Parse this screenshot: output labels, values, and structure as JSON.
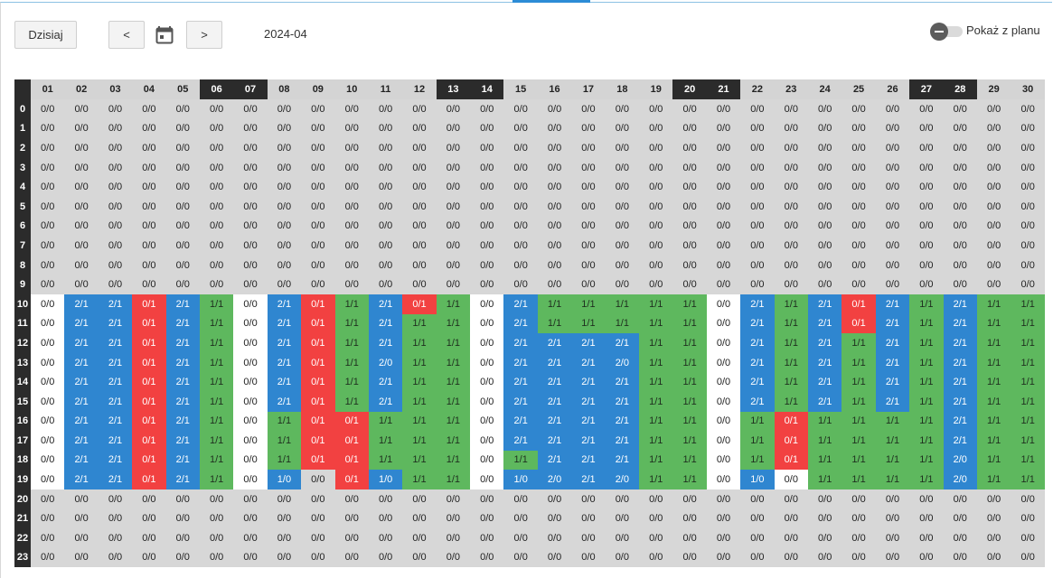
{
  "toolbar": {
    "today_label": "Dzisiaj",
    "prev_label": "<",
    "next_label": ">",
    "calendar_icon": "calendar-icon",
    "period": "2024-04",
    "show_plan_label": "Pokaż z planu",
    "show_plan_enabled": false
  },
  "colors": {
    "gray": "#d7d7d7",
    "white": "#ffffff",
    "blue": "#2f86d0",
    "green": "#5eb85e",
    "red": "#f24141",
    "header_dark": "#2b2b2b",
    "header_light": "#d4d4d4",
    "accent": "#2c8cd6"
  },
  "grid": {
    "days": [
      "01",
      "02",
      "03",
      "04",
      "05",
      "06",
      "07",
      "08",
      "09",
      "10",
      "11",
      "12",
      "13",
      "14",
      "15",
      "16",
      "17",
      "18",
      "19",
      "20",
      "21",
      "22",
      "23",
      "24",
      "25",
      "26",
      "27",
      "28",
      "29",
      "30"
    ],
    "weekend_days": [
      "06",
      "07",
      "13",
      "14",
      "20",
      "21",
      "27",
      "28"
    ],
    "hours": [
      "0",
      "1",
      "2",
      "3",
      "4",
      "5",
      "6",
      "7",
      "8",
      "9",
      "10",
      "11",
      "12",
      "13",
      "14",
      "15",
      "16",
      "17",
      "18",
      "19",
      "20",
      "21",
      "22",
      "23"
    ],
    "default_value": "0/0",
    "default_color": "gray",
    "active_hours": {
      "10": [
        "0/0|white",
        "2/1|blue",
        "2/1|blue",
        "0/1|red",
        "2/1|blue",
        "1/1|green",
        "0/0|white",
        "2/1|blue",
        "0/1|red",
        "1/1|green",
        "2/1|blue",
        "0/1|red",
        "1/1|green",
        "0/0|white",
        "2/1|blue",
        "1/1|green",
        "1/1|green",
        "1/1|green",
        "1/1|green",
        "1/1|green",
        "0/0|white",
        "2/1|blue",
        "1/1|green",
        "2/1|blue",
        "0/1|red",
        "2/1|blue",
        "1/1|green",
        "2/1|blue",
        "1/1|green",
        "1/1|green"
      ],
      "11": [
        "0/0|white",
        "2/1|blue",
        "2/1|blue",
        "0/1|red",
        "2/1|blue",
        "1/1|green",
        "0/0|white",
        "2/1|blue",
        "0/1|red",
        "1/1|green",
        "2/1|blue",
        "1/1|green",
        "1/1|green",
        "0/0|white",
        "2/1|blue",
        "1/1|green",
        "1/1|green",
        "1/1|green",
        "1/1|green",
        "1/1|green",
        "0/0|white",
        "2/1|blue",
        "1/1|green",
        "2/1|blue",
        "0/1|red",
        "2/1|blue",
        "1/1|green",
        "2/1|blue",
        "1/1|green",
        "1/1|green"
      ],
      "12": [
        "0/0|white",
        "2/1|blue",
        "2/1|blue",
        "0/1|red",
        "2/1|blue",
        "1/1|green",
        "0/0|white",
        "2/1|blue",
        "0/1|red",
        "1/1|green",
        "2/1|blue",
        "1/1|green",
        "1/1|green",
        "0/0|white",
        "2/1|blue",
        "2/1|blue",
        "2/1|blue",
        "2/1|blue",
        "1/1|green",
        "1/1|green",
        "0/0|white",
        "2/1|blue",
        "1/1|green",
        "2/1|blue",
        "1/1|green",
        "2/1|blue",
        "1/1|green",
        "2/1|blue",
        "1/1|green",
        "1/1|green"
      ],
      "13": [
        "0/0|white",
        "2/1|blue",
        "2/1|blue",
        "0/1|red",
        "2/1|blue",
        "1/1|green",
        "0/0|white",
        "2/1|blue",
        "0/1|red",
        "1/1|green",
        "2/0|blue",
        "1/1|green",
        "1/1|green",
        "0/0|white",
        "2/1|blue",
        "2/1|blue",
        "2/1|blue",
        "2/0|blue",
        "1/1|green",
        "1/1|green",
        "0/0|white",
        "2/1|blue",
        "1/1|green",
        "2/1|blue",
        "1/1|green",
        "2/1|blue",
        "1/1|green",
        "2/1|blue",
        "1/1|green",
        "1/1|green"
      ],
      "14": [
        "0/0|white",
        "2/1|blue",
        "2/1|blue",
        "0/1|red",
        "2/1|blue",
        "1/1|green",
        "0/0|white",
        "2/1|blue",
        "0/1|red",
        "1/1|green",
        "2/1|blue",
        "1/1|green",
        "1/1|green",
        "0/0|white",
        "2/1|blue",
        "2/1|blue",
        "2/1|blue",
        "2/1|blue",
        "1/1|green",
        "1/1|green",
        "0/0|white",
        "2/1|blue",
        "1/1|green",
        "2/1|blue",
        "1/1|green",
        "2/1|blue",
        "1/1|green",
        "2/1|blue",
        "1/1|green",
        "1/1|green"
      ],
      "15": [
        "0/0|white",
        "2/1|blue",
        "2/1|blue",
        "0/1|red",
        "2/1|blue",
        "1/1|green",
        "0/0|white",
        "2/1|blue",
        "0/1|red",
        "1/1|green",
        "2/1|blue",
        "1/1|green",
        "1/1|green",
        "0/0|white",
        "2/1|blue",
        "2/1|blue",
        "2/1|blue",
        "2/1|blue",
        "1/1|green",
        "1/1|green",
        "0/0|white",
        "2/1|blue",
        "1/1|green",
        "2/1|blue",
        "1/1|green",
        "2/1|blue",
        "1/1|green",
        "2/1|blue",
        "1/1|green",
        "1/1|green"
      ],
      "16": [
        "0/0|white",
        "2/1|blue",
        "2/1|blue",
        "0/1|red",
        "2/1|blue",
        "1/1|green",
        "0/0|white",
        "1/1|green",
        "0/1|red",
        "0/1|red",
        "1/1|green",
        "1/1|green",
        "1/1|green",
        "0/0|white",
        "2/1|blue",
        "2/1|blue",
        "2/1|blue",
        "2/1|blue",
        "1/1|green",
        "1/1|green",
        "0/0|white",
        "1/1|green",
        "0/1|red",
        "1/1|green",
        "1/1|green",
        "1/1|green",
        "1/1|green",
        "2/1|blue",
        "1/1|green",
        "1/1|green"
      ],
      "17": [
        "0/0|white",
        "2/1|blue",
        "2/1|blue",
        "0/1|red",
        "2/1|blue",
        "1/1|green",
        "0/0|white",
        "1/1|green",
        "0/1|red",
        "0/1|red",
        "1/1|green",
        "1/1|green",
        "1/1|green",
        "0/0|white",
        "2/1|blue",
        "2/1|blue",
        "2/1|blue",
        "2/1|blue",
        "1/1|green",
        "1/1|green",
        "0/0|white",
        "1/1|green",
        "0/1|red",
        "1/1|green",
        "1/1|green",
        "1/1|green",
        "1/1|green",
        "2/1|blue",
        "1/1|green",
        "1/1|green"
      ],
      "18": [
        "0/0|white",
        "2/1|blue",
        "2/1|blue",
        "0/1|red",
        "2/1|blue",
        "1/1|green",
        "0/0|white",
        "1/1|green",
        "0/1|red",
        "0/1|red",
        "1/1|green",
        "1/1|green",
        "1/1|green",
        "0/0|white",
        "1/1|green",
        "2/1|blue",
        "2/1|blue",
        "2/1|blue",
        "1/1|green",
        "1/1|green",
        "0/0|white",
        "1/1|green",
        "0/1|red",
        "1/1|green",
        "1/1|green",
        "1/1|green",
        "1/1|green",
        "2/0|blue",
        "1/1|green",
        "1/1|green"
      ],
      "19": [
        "0/0|white",
        "2/1|blue",
        "2/1|blue",
        "0/1|red",
        "2/1|blue",
        "1/1|green",
        "0/0|white",
        "1/0|blue",
        "0/0|gray",
        "0/1|red",
        "1/0|blue",
        "1/1|green",
        "1/1|green",
        "0/0|white",
        "1/0|blue",
        "2/0|blue",
        "2/1|blue",
        "2/0|blue",
        "1/1|green",
        "1/1|green",
        "0/0|white",
        "1/0|blue",
        "0/0|white",
        "1/1|green",
        "1/1|green",
        "1/1|green",
        "1/1|green",
        "2/0|blue",
        "1/1|green",
        "1/1|green"
      ]
    }
  }
}
